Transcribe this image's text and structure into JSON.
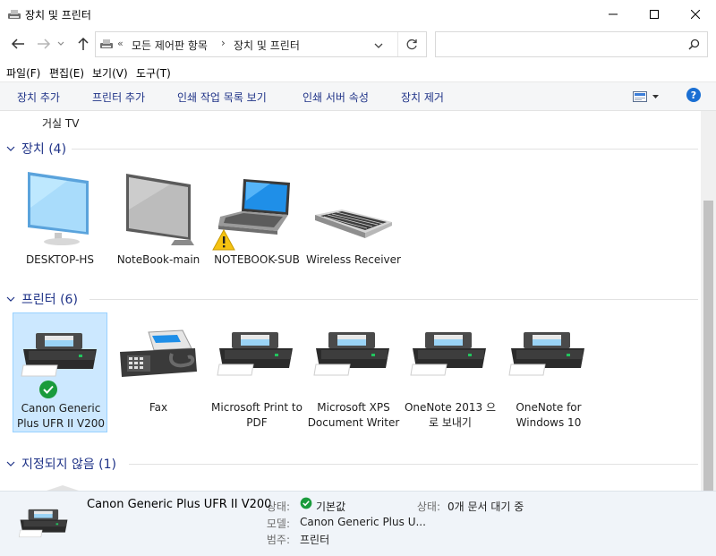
{
  "window": {
    "title": "장치 및 프린터",
    "controls": {
      "minimize": "minimize",
      "maximize": "maximize",
      "close": "close"
    }
  },
  "address": {
    "overflow": "«",
    "crumbs": [
      "모든 제어판 항목",
      "장치 및 프린터"
    ],
    "separator": "›",
    "search_placeholder": ""
  },
  "menu": [
    "파일(F)",
    "편집(E)",
    "보기(V)",
    "도구(T)"
  ],
  "commands": [
    "장치 추가",
    "프린터 추가",
    "인쇄 작업 목록 보기",
    "인쇄 서버 속성",
    "장치 제거"
  ],
  "partial_item": "거실 TV",
  "groups": {
    "devices": {
      "title": "장치 (4)"
    },
    "printers": {
      "title": "프린터 (6)"
    },
    "unspecified": {
      "title": "지정되지 않음 (1)"
    }
  },
  "devices": [
    {
      "name": "DESKTOP-HS",
      "icon": "monitor-icon"
    },
    {
      "name": "NoteBook-main",
      "icon": "monitor-icon"
    },
    {
      "name": "NOTEBOOK-SUB",
      "icon": "laptop-icon",
      "warning": true
    },
    {
      "name": "Wireless Receiver",
      "icon": "keyboard-icon"
    }
  ],
  "printers": [
    {
      "name": "Canon Generic Plus UFR II V200",
      "icon": "printer-icon",
      "default": true,
      "selected": true
    },
    {
      "name": "Fax",
      "icon": "fax-icon"
    },
    {
      "name": "Microsoft Print to PDF",
      "icon": "printer-icon"
    },
    {
      "name": "Microsoft XPS Document Writer",
      "icon": "printer-icon"
    },
    {
      "name": "OneNote 2013 으로 보내기",
      "icon": "printer-icon"
    },
    {
      "name": "OneNote for Windows 10",
      "icon": "printer-icon"
    }
  ],
  "details": {
    "name": "Canon Generic Plus UFR II V200",
    "status_label": "상태:",
    "status_value": "기본값",
    "model_label": "모델:",
    "model_value": "Canon Generic Plus U...",
    "category_label": "범주:",
    "category_value": "프린터",
    "queue_label": "상태:",
    "queue_value": "0개 문서 대기 중"
  },
  "colors": {
    "accent_text": "#1e3287",
    "selection": "#cce8ff",
    "default_check": "#1a9b3c",
    "warning": "#f5c211",
    "help": "#1a6fd3"
  }
}
